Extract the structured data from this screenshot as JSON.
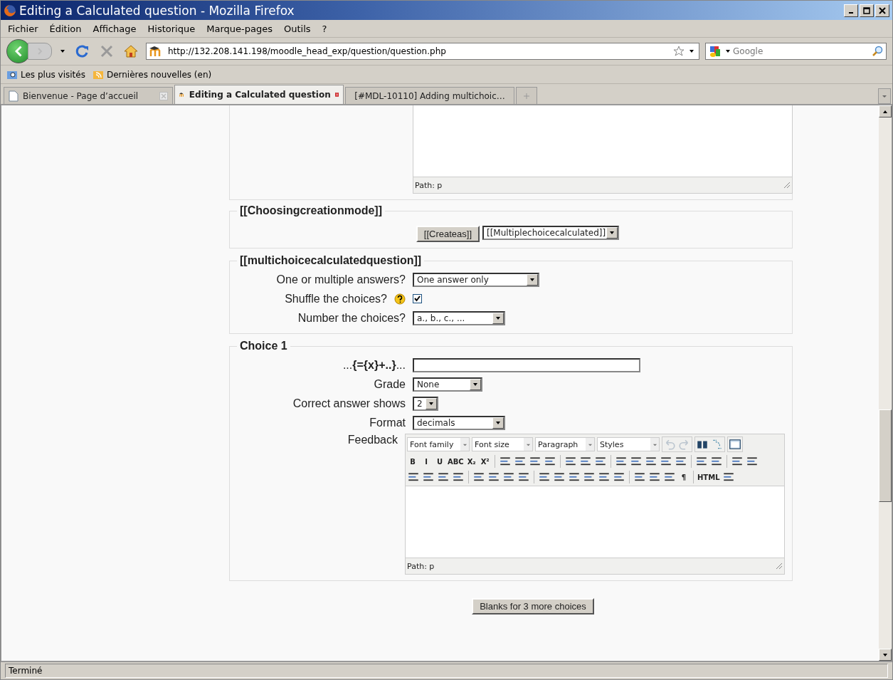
{
  "window": {
    "title": "Editing a Calculated question - Mozilla Firefox"
  },
  "menu": [
    "Fichier",
    "Édition",
    "Affichage",
    "Historique",
    "Marque-pages",
    "Outils",
    "?"
  ],
  "address": {
    "value": "http://132.208.141.198/moodle_head_exp/question/question.php"
  },
  "search": {
    "placeholder": "Google"
  },
  "bookmarks": [
    "Les plus visités",
    "Dernières nouvelles (en)"
  ],
  "tabs": [
    {
      "label": "Bienvenue - Page d’accueil",
      "selected": false
    },
    {
      "label": "Editing a Calculated question",
      "selected": true
    },
    {
      "label": "[#MDL-10110] Adding multichoic…",
      "selected": false
    }
  ],
  "top_editor": {
    "path": "Path: p"
  },
  "creation": {
    "legend": "[[Choosingcreationmode]]",
    "button": "[[Createas]]",
    "select": "[[Multiplechoicecalculated]]"
  },
  "question": {
    "legend": "[[multichoicecalculatedquestion]]",
    "rows": [
      {
        "kind": "select",
        "label": "One or multiple answers?",
        "value": "One answer only"
      },
      {
        "kind": "checkbox",
        "label": "Shuffle the choices?",
        "checked": true
      },
      {
        "kind": "select",
        "label": "Number the choices?",
        "value": "a., b., c., ..."
      }
    ]
  },
  "choice": {
    "legend": "Choice 1",
    "rows": [
      {
        "kind": "text",
        "label": "...**{={x}+..}**..."
      },
      {
        "kind": "select",
        "label": "Grade",
        "value": "None"
      },
      {
        "kind": "select",
        "label": "Correct answer shows",
        "value": "2"
      },
      {
        "kind": "select",
        "label": "Format",
        "value": "decimals"
      }
    ],
    "feedback_label": "Feedback",
    "editor_selects": [
      "Font family",
      "Font size",
      "Paragraph",
      "Styles"
    ],
    "glyphs": [
      "B",
      "I",
      "U",
      "ABC",
      "X₂",
      "X²",
      "¶",
      "HTML"
    ],
    "path": "Path: p"
  },
  "more_button": "Blanks for 3 more choices",
  "status_bar": "Terminé"
}
